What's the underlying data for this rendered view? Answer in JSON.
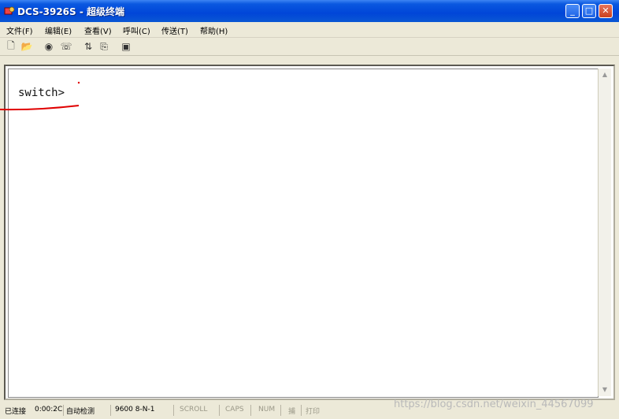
{
  "window": {
    "title": "DCS-3926S - 超级终端"
  },
  "menu": [
    {
      "label": "文件(F)"
    },
    {
      "label": "编辑(E)"
    },
    {
      "label": "查看(V)"
    },
    {
      "label": "呼叫(C)"
    },
    {
      "label": "传送(T)"
    },
    {
      "label": "帮助(H)"
    }
  ],
  "toolbar": [
    {
      "name": "new-icon",
      "glyph": "🗋"
    },
    {
      "name": "open-folder-icon",
      "glyph": "📂"
    },
    {
      "name": "disconnect-icon",
      "glyph": "◉"
    },
    {
      "name": "phone-icon",
      "glyph": "☏"
    },
    {
      "name": "send-icon",
      "glyph": "⇅"
    },
    {
      "name": "receive-icon",
      "glyph": "⎘"
    },
    {
      "name": "properties-icon",
      "glyph": "▣"
    }
  ],
  "terminal": {
    "prompt": "switch>"
  },
  "status": {
    "connection": "已连接",
    "elapsed": "0:00:2C",
    "detect": "自动检测",
    "baud": "9600 8-N-1",
    "scroll": "SCROLL",
    "caps": "CAPS",
    "num": "NUM",
    "capture": "捕",
    "print": "打印"
  },
  "watermark": "https://blog.csdn.net/weixin_44567099",
  "colors": {
    "titlebar": "#0a57d4",
    "annotation": "#e00000",
    "face": "#ece9d8"
  }
}
